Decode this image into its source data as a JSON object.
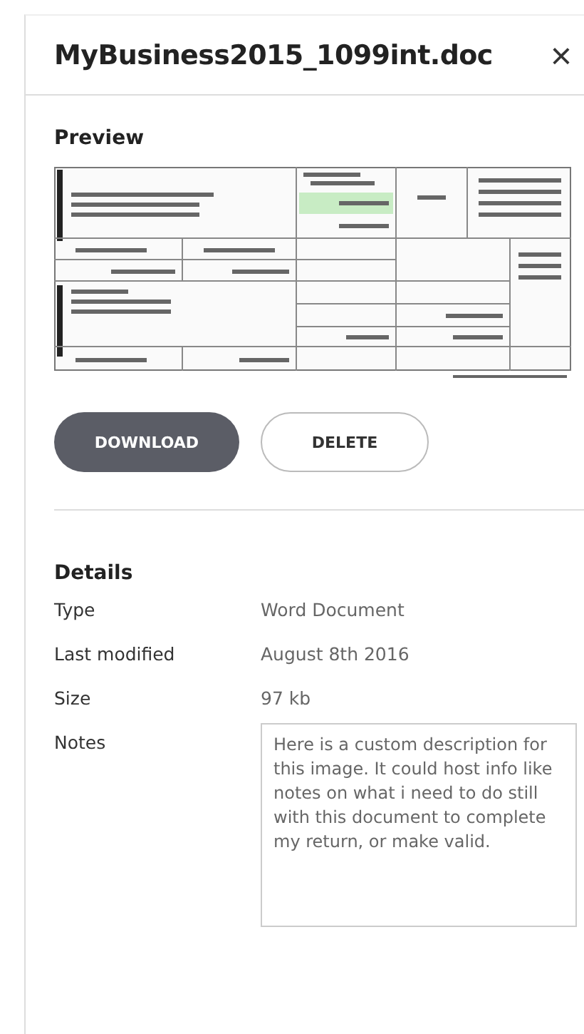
{
  "title": "MyBusiness2015_1099int.doc",
  "close": "×",
  "preview": {
    "heading": "Preview"
  },
  "buttons": [
    {
      "label": "DOWNLOAD",
      "kind": "primary"
    },
    {
      "label": "DELETE",
      "kind": "secondary"
    }
  ],
  "details": {
    "heading": "Details",
    "rows": [
      {
        "label": "Type",
        "value": "Word Document"
      },
      {
        "label": "Last modified",
        "value": "August 8th 2016"
      },
      {
        "label": "Size",
        "value": "97 kb"
      }
    ],
    "notes": {
      "label": "Notes",
      "value": "Here is a custom description for this image. It could host info like notes on what i need to do still with this document to complete my return, or make valid."
    }
  }
}
